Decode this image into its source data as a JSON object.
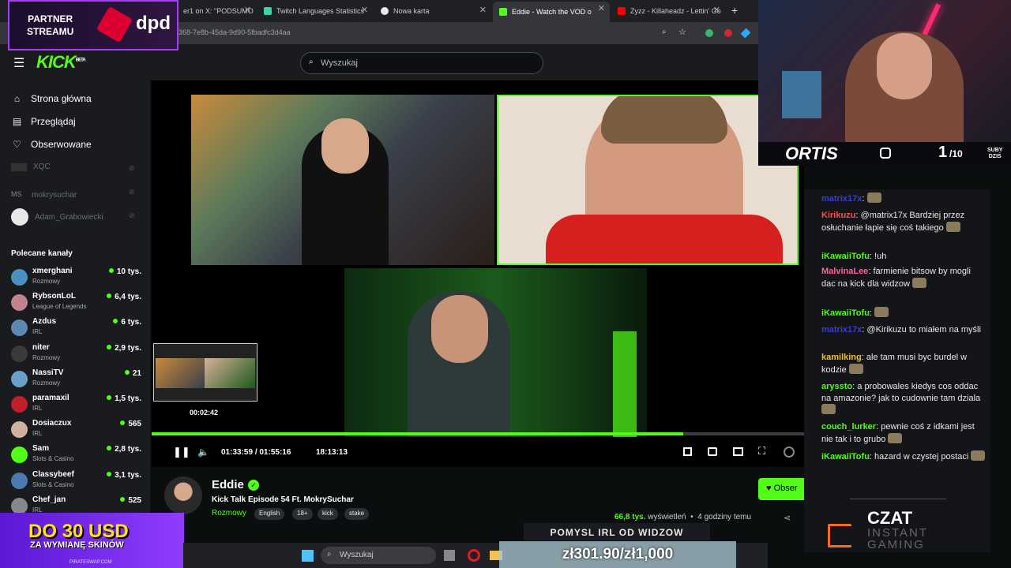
{
  "tabs": [
    {
      "label": "er1 on X: \"PODSUMO"
    },
    {
      "label": "Twitch Languages Statistics"
    },
    {
      "label": "Nowa karta"
    },
    {
      "label": "Eddie - Watch the VOD o"
    },
    {
      "label": "Zyzz - Killaheadz - Lettin' Go"
    }
  ],
  "url": "368-7e8b-45da-9d90-5fbadfc3d4aa",
  "overlay": {
    "partner_line1": "PARTNER",
    "partner_line2": "STREAMU",
    "partner_brand": "dpd",
    "promo_line1": "DO 30 USD",
    "promo_line2": "ZA WYMIANĘ SKINÓW",
    "promo_site": "PIRATESWAP.COM",
    "cam_name": "ORTIS",
    "subs_count": "1",
    "subs_goal": "/10",
    "subs_label1": "SUBY",
    "subs_label2": "DZIŚ",
    "idea_banner": "POMYSL IRL OD WIDZOW",
    "money": "zł301.90/zł1,000",
    "czat_title": "CZAT",
    "czat_sub1": "INSTANT",
    "czat_sub2": "GAMING"
  },
  "kick": {
    "logo": "KICK",
    "beta": "BETA",
    "search_placeholder": "Wyszukaj"
  },
  "sidebar": {
    "nav": [
      "Strona główna",
      "Przeglądaj",
      "Obserwowane"
    ],
    "followed": [
      "XQC",
      "mokrysuchar",
      "Adam_Grabowiecki"
    ],
    "followed_initials": "MS",
    "recommended_title": "Polecane kanały",
    "channels": [
      {
        "name": "xmerghani",
        "category": "Rozmowy",
        "viewers": "10 tys."
      },
      {
        "name": "RybsonLoL",
        "category": "League of Legends",
        "viewers": "6,4 tys."
      },
      {
        "name": "Azdus",
        "category": "IRL",
        "viewers": "6 tys."
      },
      {
        "name": "niter",
        "category": "Rozmowy",
        "viewers": "2,9 tys."
      },
      {
        "name": "NassiTV",
        "category": "Rozmowy",
        "viewers": "21"
      },
      {
        "name": "paramaxil",
        "category": "IRL",
        "viewers": "1,5 tys."
      },
      {
        "name": "Dosiaczux",
        "category": "IRL",
        "viewers": "565"
      },
      {
        "name": "Sam",
        "category": "Slots & Casino",
        "viewers": "2,8 tys."
      },
      {
        "name": "Classybeef",
        "category": "Slots & Casino",
        "viewers": "3,1 tys."
      },
      {
        "name": "Chef_jan",
        "category": "IRL",
        "viewers": "525"
      }
    ]
  },
  "player": {
    "preview_time": "00:02:42",
    "current_time": "01:33:59",
    "separator": "/",
    "duration": "01:55:16",
    "clock": "18:13:13",
    "progress": 0.8145
  },
  "stream": {
    "streamer": "Eddie",
    "title": "Kick Talk Episode 54 Ft. MokrySuchar",
    "category": "Rozmowy",
    "tags": [
      "English",
      "18+",
      "kick",
      "stake"
    ],
    "follow_label": "Obser",
    "views": "66,8 tys.",
    "views_label": "wyświetleń",
    "time_ago": "4 godziny temu"
  },
  "chat": [
    {
      "user": "matrix17x",
      "text": "",
      "color": "#3b3bd6"
    },
    {
      "user": "Kirikuzu",
      "text": "@matrix17x Bardziej przez osłuchanie łapie się coś takiego",
      "color": "#ff4d4d"
    },
    {
      "user": "iKawaiiTofu",
      "text": "!uh",
      "color": "#53fc18"
    },
    {
      "user": "MalvinaLee",
      "text": "farmienie bitsow by mogli dac na kick dla widzow",
      "color": "#ff5fa2"
    },
    {
      "user": "iKawaiiTofu",
      "text": "",
      "color": "#53fc18"
    },
    {
      "user": "matrix17x",
      "text": "@Kirikuzu to miałem na myśli",
      "color": "#3b3bd6"
    },
    {
      "user": "kamilking",
      "text": "ale tam musi byc burdel w kodzie",
      "color": "#f0c020"
    },
    {
      "user": "aryssto",
      "text": "a probowales kiedys cos oddac na amazonie? jak to cudownie tam dziala",
      "color": "#53fc18"
    },
    {
      "user": "couch_lurker",
      "text": "pewnie coś z idkami jest nie tak i to grubo",
      "color": "#53fc18"
    },
    {
      "user": "iKawaiiTofu",
      "text": "hazard w czystej postaci",
      "color": "#53fc18"
    }
  ],
  "taskbar": {
    "search_placeholder": "Wyszukaj"
  },
  "colors": {
    "kick_green": "#53fc18",
    "sidebar_bg": "#191b1f"
  }
}
